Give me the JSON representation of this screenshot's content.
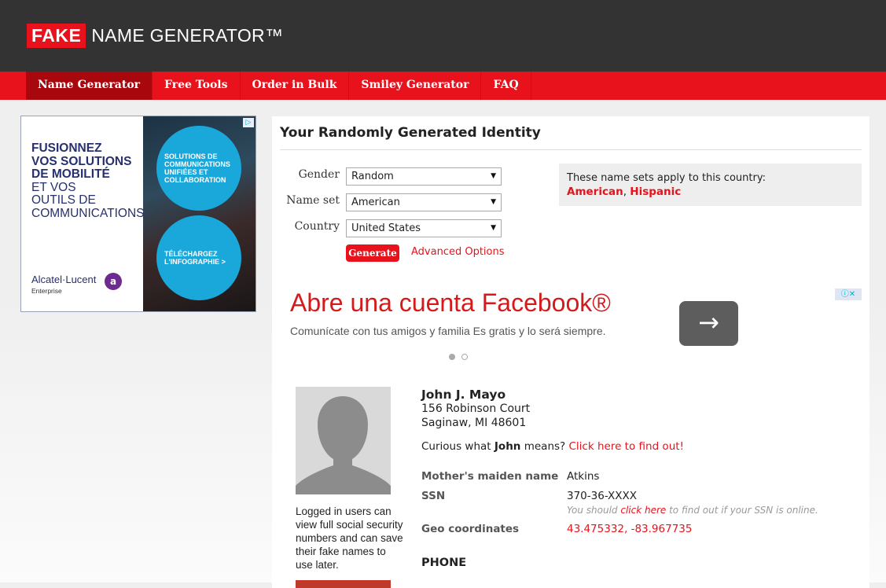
{
  "header": {
    "logo_badge": "FAKE",
    "logo_text": "NAME GENERATOR™"
  },
  "nav": {
    "items": [
      {
        "label": "Name Generator",
        "active": true
      },
      {
        "label": "Free Tools"
      },
      {
        "label": "Order in Bulk"
      },
      {
        "label": "Smiley Generator"
      },
      {
        "label": "FAQ"
      }
    ]
  },
  "left_ad": {
    "bold_lines": [
      "FUSIONNEZ",
      "VOS SOLUTIONS",
      "DE MOBILITÉ"
    ],
    "lines": [
      "ET VOS",
      "OUTILS DE",
      "COMMUNICATIONS"
    ],
    "circle1": "SOLUTIONS DE COMMUNICATIONS UNIFIÉES ET COLLABORATION",
    "circle2": "TÉLÉCHARGEZ L'INFOGRAPHIE >",
    "brand": "Alcatel·Lucent",
    "brand_sub": "Enterprise",
    "adchoice": "▷"
  },
  "content": {
    "title": "Your Randomly Generated Identity",
    "form": {
      "gender_label": "Gender",
      "gender_value": "Random",
      "nameset_label": "Name set",
      "nameset_value": "American",
      "country_label": "Country",
      "country_value": "United States",
      "generate_label": "Generate",
      "advanced_label": "Advanced Options"
    },
    "country_box": {
      "intro": "These name sets apply to this country:",
      "set1": "American",
      "sep": ", ",
      "set2": "Hispanic"
    },
    "banner": {
      "headline": "Abre una cuenta Facebook®",
      "sub": "Comunícate con tus amigos y familia Es gratis y lo será siempre.",
      "arrow": "→",
      "icons": "ⓘ✕"
    },
    "identity": {
      "name": "John J. Mayo",
      "street": "156 Robinson Court",
      "city": "Saginaw, MI 48601",
      "curious_pre": "Curious what ",
      "curious_name": "John",
      "curious_mid": " means? ",
      "curious_link": "Click here to find out!",
      "login_note": "Logged in users can view full social security numbers and can save their fake names to use later.",
      "maiden_label": "Mother's maiden name",
      "maiden_value": "Atkins",
      "ssn_label": "SSN",
      "ssn_value": "370-36-XXXX",
      "ssn_hint_pre": "You should ",
      "ssn_hint_link": "click here",
      "ssn_hint_post": " to find out if your SSN is online.",
      "geo_label": "Geo coordinates",
      "geo_value": "43.475332, -83.967735",
      "phone_heading": "PHONE"
    }
  }
}
